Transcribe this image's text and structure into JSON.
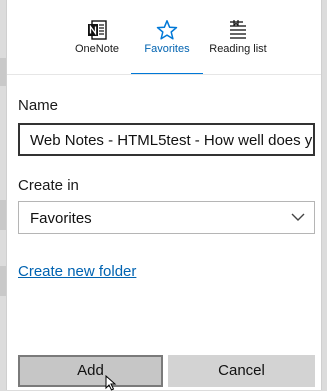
{
  "tabs": [
    {
      "label": "OneNote",
      "icon": "onenote-icon"
    },
    {
      "label": "Favorites",
      "icon": "star-icon",
      "selected": true
    },
    {
      "label": "Reading list",
      "icon": "reading-list-icon"
    }
  ],
  "form": {
    "name_label": "Name",
    "name_value": "Web Notes - HTML5test - How well does y",
    "create_in_label": "Create in",
    "create_in_value": "Favorites",
    "create_folder_link": "Create new folder"
  },
  "buttons": {
    "add": "Add",
    "cancel": "Cancel"
  },
  "colors": {
    "accent": "#0078d7",
    "link": "#0063b1"
  }
}
